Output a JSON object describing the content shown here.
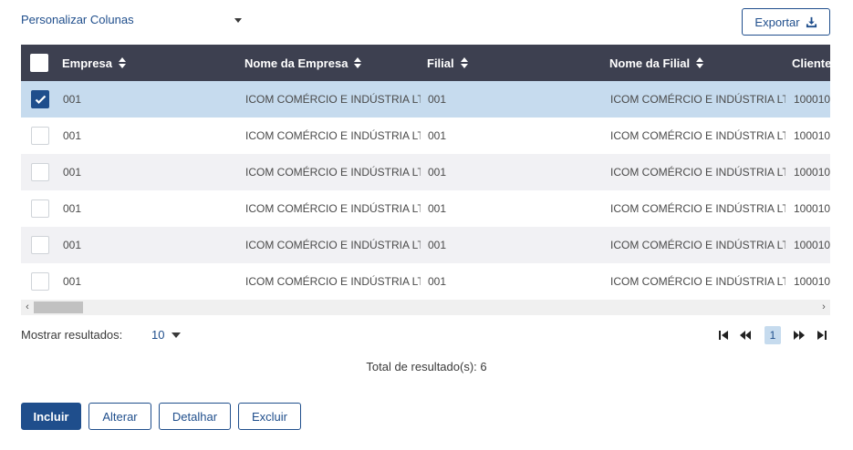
{
  "toolbar": {
    "customize_label": "Personalizar Colunas",
    "export_label": "Exportar"
  },
  "grid": {
    "columns": [
      "Empresa",
      "Nome da Empresa",
      "Filial",
      "Nome da Filial",
      "Cliente"
    ],
    "rows": [
      {
        "selected": true,
        "empresa": "001",
        "nome_empresa": "ICOM COMÉRCIO E INDÚSTRIA LTD.",
        "filial": "001",
        "nome_filial": "ICOM COMÉRCIO E INDÚSTRIA LTD.",
        "cliente": "100010"
      },
      {
        "selected": false,
        "empresa": "001",
        "nome_empresa": "ICOM COMÉRCIO E INDÚSTRIA LTD.",
        "filial": "001",
        "nome_filial": "ICOM COMÉRCIO E INDÚSTRIA LTD.",
        "cliente": "100010"
      },
      {
        "selected": false,
        "empresa": "001",
        "nome_empresa": "ICOM COMÉRCIO E INDÚSTRIA LTD.",
        "filial": "001",
        "nome_filial": "ICOM COMÉRCIO E INDÚSTRIA LTD.",
        "cliente": "100010"
      },
      {
        "selected": false,
        "empresa": "001",
        "nome_empresa": "ICOM COMÉRCIO E INDÚSTRIA LTD.",
        "filial": "001",
        "nome_filial": "ICOM COMÉRCIO E INDÚSTRIA LTD.",
        "cliente": "100010"
      },
      {
        "selected": false,
        "empresa": "001",
        "nome_empresa": "ICOM COMÉRCIO E INDÚSTRIA LTD.",
        "filial": "001",
        "nome_filial": "ICOM COMÉRCIO E INDÚSTRIA LTD.",
        "cliente": "100010"
      },
      {
        "selected": false,
        "empresa": "001",
        "nome_empresa": "ICOM COMÉRCIO E INDÚSTRIA LTD.",
        "filial": "001",
        "nome_filial": "ICOM COMÉRCIO E INDÚSTRIA LTD.",
        "cliente": "100010"
      }
    ]
  },
  "pagination": {
    "show_results_label": "Mostrar resultados:",
    "page_size": "10",
    "current_page": "1",
    "total_label": "Total de resultado(s): 6"
  },
  "actions": {
    "include": "Incluir",
    "edit": "Alterar",
    "detail": "Detalhar",
    "delete": "Excluir"
  },
  "colors": {
    "primary": "#1f4e8c",
    "header_bg": "#3d4050",
    "selected_row": "#c6dbee",
    "alt_row": "#f1f1f4"
  }
}
